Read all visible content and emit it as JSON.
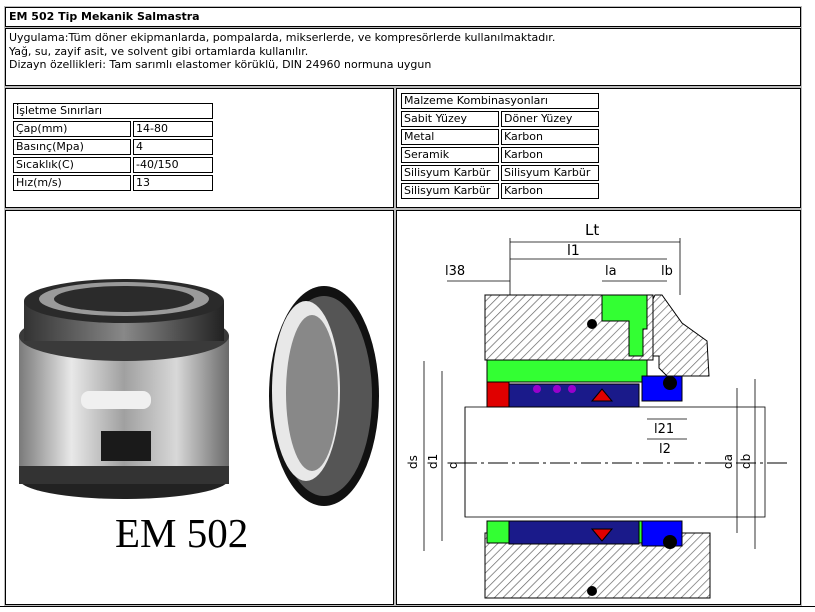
{
  "title": "EM 502 Tip Mekanik Salmastra",
  "description": [
    "Uygulama:Tüm döner ekipmanlarda, pompalarda, mikserlerde, ve kompresörlerde kullanılmaktadır.",
    "Yağ, su, zayif asit, ve solvent gibi ortamlarda kullanılır.",
    "Dizayn özellikleri: Tam sarımlı elastomer körüklü, DIN 24960 normuna uygun"
  ],
  "limits": {
    "header": "İşletme Sınırları",
    "rows": [
      {
        "label": "Çap(mm)",
        "value": "14-80"
      },
      {
        "label": "Basınç(Mpa)",
        "value": "4"
      },
      {
        "label": "Sıcaklık(C)",
        "value": "-40/150"
      },
      {
        "label": "Hız(m/s)",
        "value": "13"
      }
    ]
  },
  "materials": {
    "header": "Malzeme Kombinasyonları",
    "columns": [
      "Sabit Yüzey",
      "Döner Yüzey"
    ],
    "rows": [
      [
        "Metal",
        "Karbon"
      ],
      [
        "Seramik",
        "Karbon"
      ],
      [
        "Silisyum Karbür",
        "Silisyum Karbür"
      ],
      [
        "Silisyum Karbür",
        "Karbon"
      ]
    ]
  },
  "product_label": "EM 502",
  "drawing_labels": {
    "lt": "Lt",
    "l1": "l1",
    "l38": "l38",
    "la": "la",
    "lb": "lb",
    "l21": "l21",
    "l2": "l2",
    "ds": "ds",
    "d1": "d1",
    "d": "d",
    "da": "da",
    "db": "db"
  },
  "colors": {
    "green": "#33ff33",
    "red": "#e00000",
    "blue": "#0000ff",
    "purple": "#9900cc",
    "hatch": "#888888"
  }
}
